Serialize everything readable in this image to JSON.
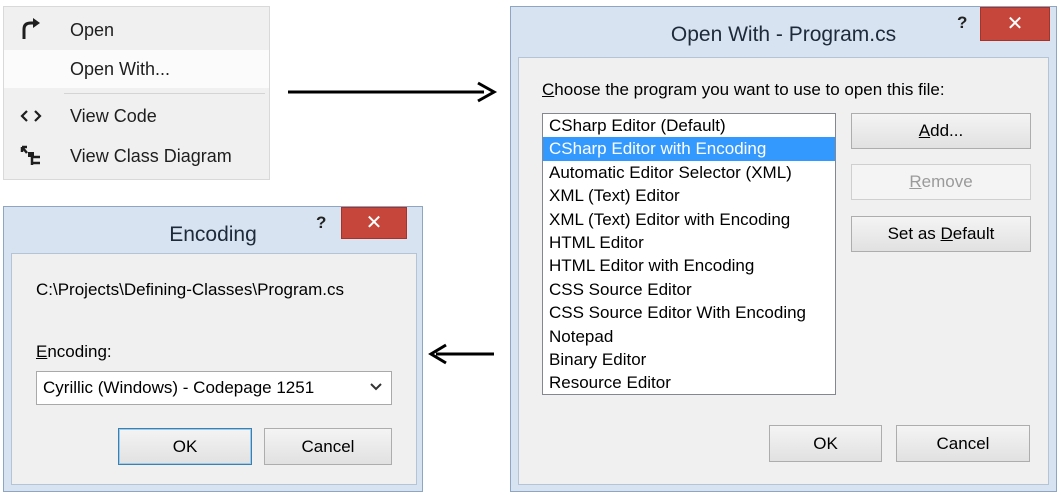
{
  "context_menu": {
    "items": [
      {
        "label": "Open",
        "icon": "open-arrow-icon"
      },
      {
        "label": "Open With...",
        "icon": ""
      },
      {
        "label": "View Code",
        "icon": "code-brackets-icon"
      },
      {
        "label": "View Class Diagram",
        "icon": "class-diagram-icon"
      }
    ]
  },
  "open_with": {
    "title": "Open With - Program.cs",
    "help": "?",
    "close": "✕",
    "prompt_pre": "",
    "prompt_hot": "C",
    "prompt_post": "hoose the program you want to use to open this file:",
    "programs": [
      "CSharp Editor (Default)",
      "CSharp Editor with Encoding",
      "Automatic Editor Selector (XML)",
      "XML (Text) Editor",
      "XML (Text) Editor with Encoding",
      "HTML Editor",
      "HTML Editor with Encoding",
      "CSS Source Editor",
      "CSS Source Editor With Encoding",
      "Notepad",
      "Binary Editor",
      "Resource Editor"
    ],
    "selected_index": 1,
    "add_hot": "A",
    "add_rest": "dd...",
    "remove_hot": "R",
    "remove_rest": "emove",
    "setdef_pre": "Set as ",
    "setdef_hot": "D",
    "setdef_rest": "efault",
    "ok": "OK",
    "cancel": "Cancel"
  },
  "encoding": {
    "title": "Encoding",
    "help": "?",
    "close": "✕",
    "path": "C:\\Projects\\Defining-Classes\\Program.cs",
    "label_hot": "E",
    "label_rest": "ncoding:",
    "selected": "Cyrillic (Windows) - Codepage 1251",
    "ok": "OK",
    "cancel": "Cancel"
  },
  "colors": {
    "selection": "#3399ff",
    "close_button": "#c7463b",
    "dialog_frame": "#d7e3f0"
  }
}
